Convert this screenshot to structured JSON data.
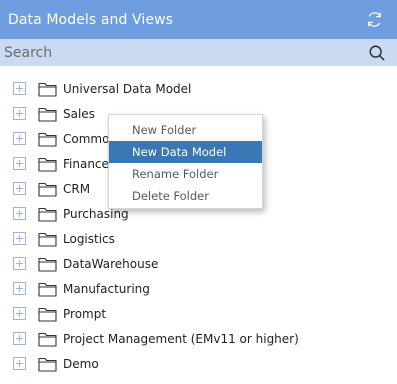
{
  "header": {
    "title": "Data Models and Views",
    "refresh_icon": "refresh-icon"
  },
  "search": {
    "placeholder": "Search",
    "value": "",
    "icon": "search-icon"
  },
  "tree": {
    "items": [
      {
        "label": "Universal Data Model"
      },
      {
        "label": "Sales"
      },
      {
        "label": "Common"
      },
      {
        "label": "Finance"
      },
      {
        "label": "CRM"
      },
      {
        "label": "Purchasing"
      },
      {
        "label": "Logistics"
      },
      {
        "label": "DataWarehouse"
      },
      {
        "label": "Manufacturing"
      },
      {
        "label": "Prompt"
      },
      {
        "label": "Project Management (EMv11 or higher)"
      },
      {
        "label": "Demo"
      }
    ]
  },
  "context_menu": {
    "items": [
      {
        "label": "New Folder"
      },
      {
        "label": "New Data Model",
        "highlighted": true
      },
      {
        "label": "Rename Folder"
      },
      {
        "label": "Delete Folder"
      }
    ]
  },
  "colors": {
    "header_bg": "#6f9ee0",
    "search_bg": "#c9daf2",
    "menu_highlight": "#3a78b5"
  }
}
